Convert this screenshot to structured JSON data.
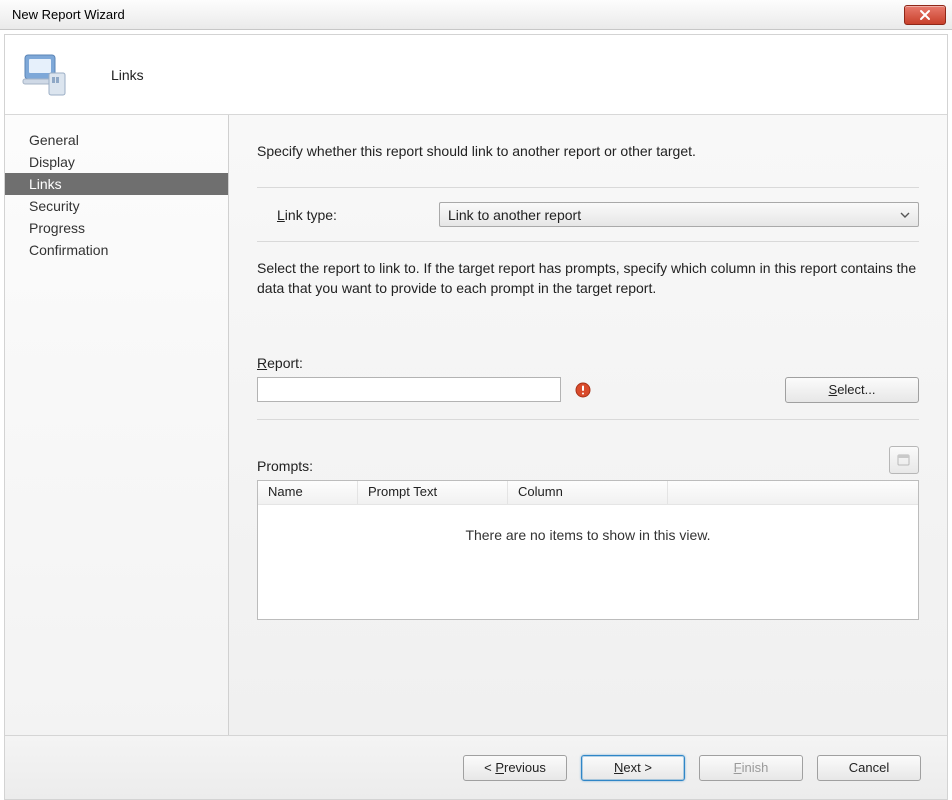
{
  "titlebar": {
    "title": "New Report Wizard"
  },
  "header": {
    "page_title": "Links"
  },
  "sidebar": {
    "items": [
      {
        "label": "General"
      },
      {
        "label": "Display"
      },
      {
        "label": "Links"
      },
      {
        "label": "Security"
      },
      {
        "label": "Progress"
      },
      {
        "label": "Confirmation"
      }
    ],
    "selected_index": 2
  },
  "main": {
    "description_top": "Specify whether this report should link to another report or other target.",
    "link_type_label_prefix": "L",
    "link_type_label_rest": "ink type:",
    "link_type_value": "Link to another report",
    "description_sub": "Select the report to link to. If the target report has prompts, specify which column in this report contains the data that you want to provide to each prompt in the target report.",
    "report_label_prefix": "R",
    "report_label_rest": "eport:",
    "report_value": "",
    "select_button_prefix": "S",
    "select_button_rest": "elect...",
    "prompts_label": "Prompts:",
    "table": {
      "headers": {
        "name": "Name",
        "prompt": "Prompt Text",
        "column": "Column"
      },
      "empty_message": "There are no items to show in this view."
    }
  },
  "footer": {
    "previous_prefix": "< ",
    "previous_key": "P",
    "previous_rest": "revious",
    "next_key": "N",
    "next_rest": "ext >",
    "finish_key": "F",
    "finish_rest": "inish",
    "cancel": "Cancel"
  }
}
